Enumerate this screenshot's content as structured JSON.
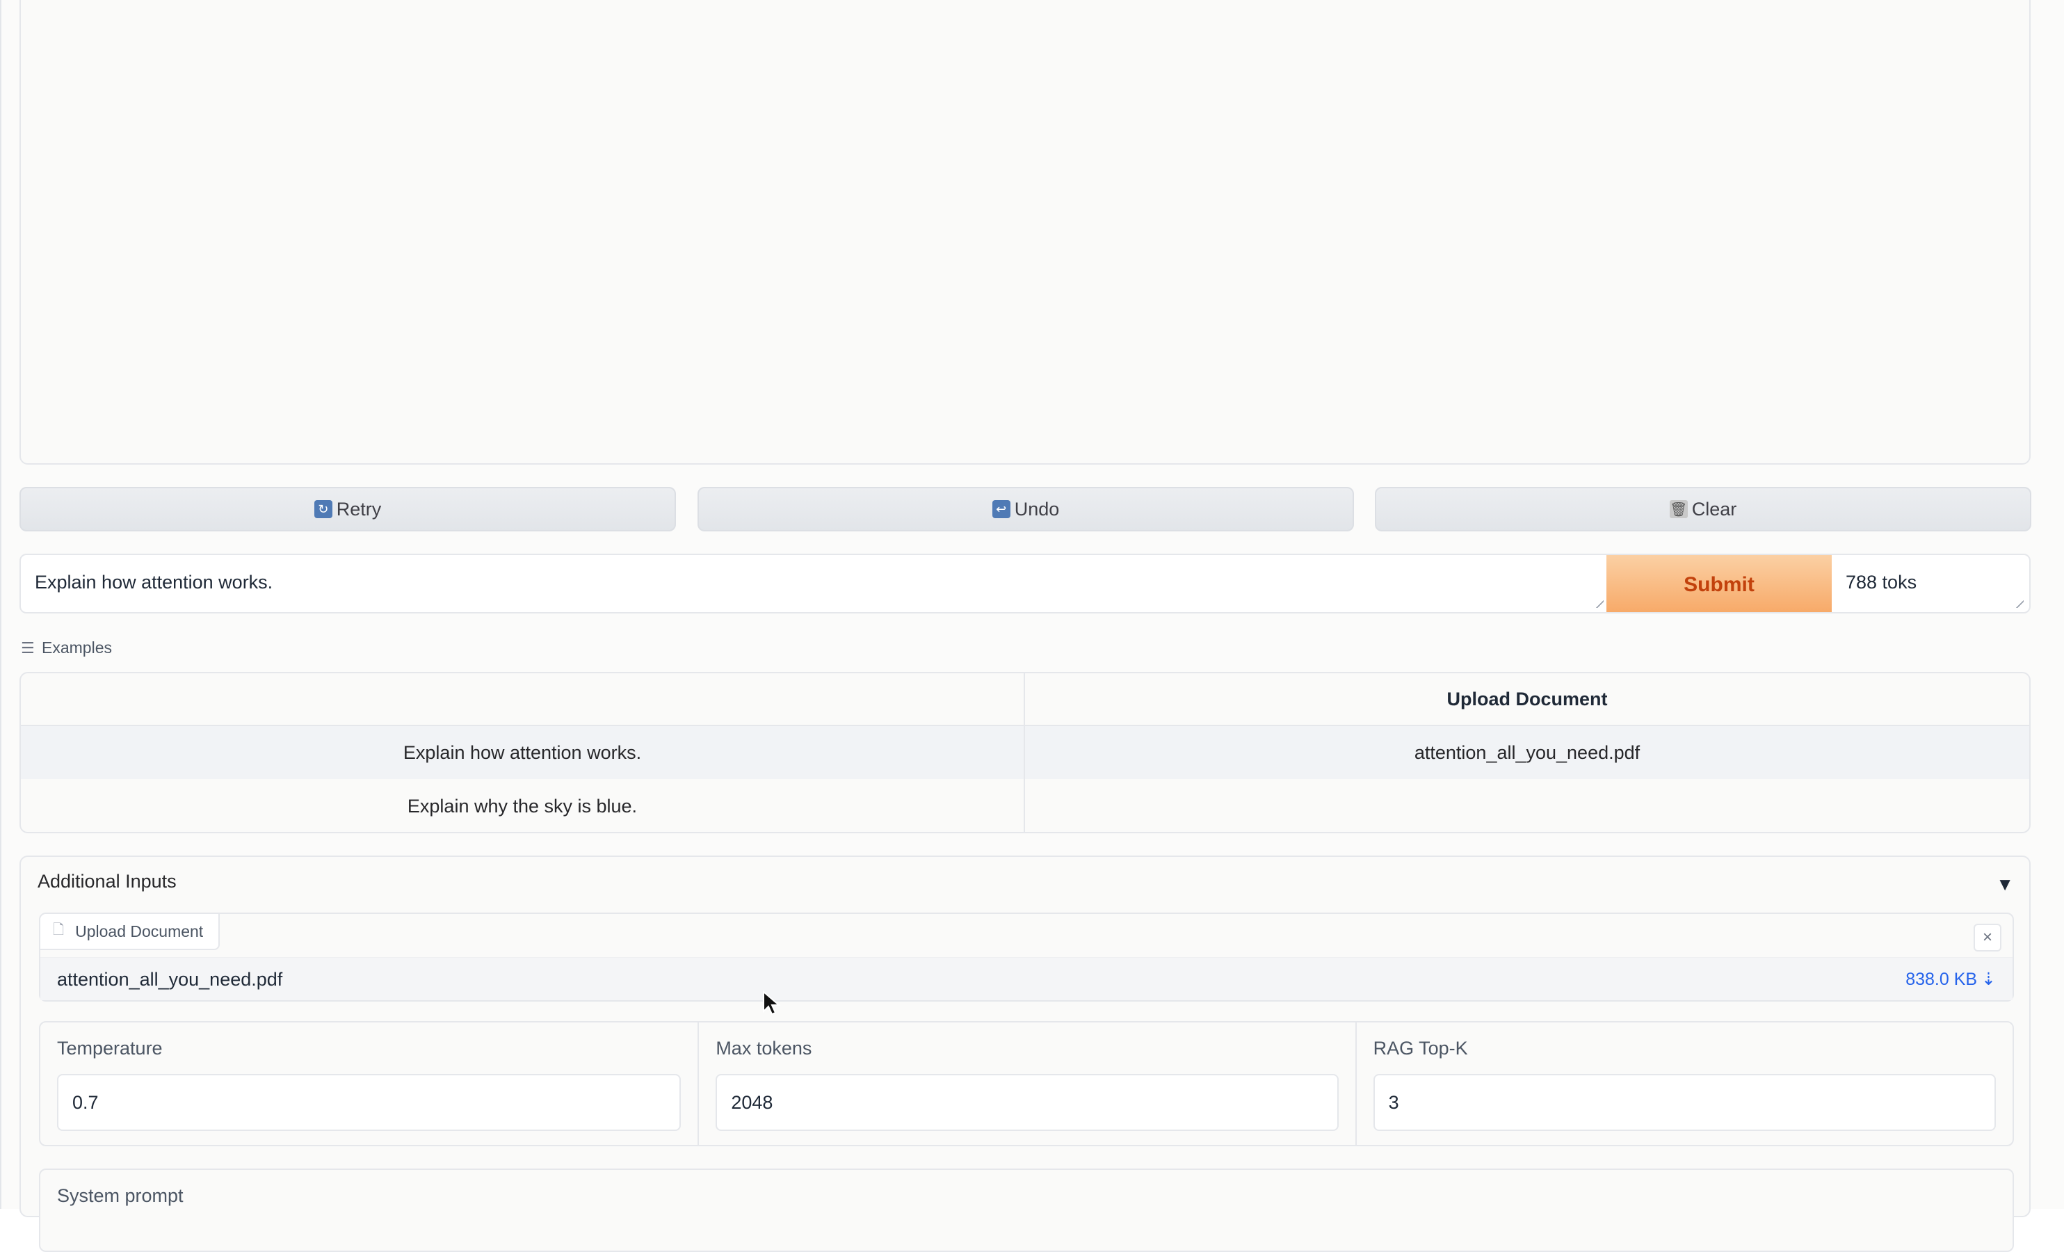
{
  "actions": {
    "retry": {
      "label": "Retry",
      "icon": "retry-icon"
    },
    "undo": {
      "label": "Undo",
      "icon": "undo-icon"
    },
    "clear": {
      "label": "Clear",
      "icon": "trash-icon"
    }
  },
  "message_input": {
    "value": "Explain how attention works.",
    "submit_label": "Submit",
    "token_count": "788 toks"
  },
  "examples": {
    "label": "Examples",
    "columns": [
      "",
      "Upload Document"
    ],
    "rows": [
      [
        "Explain how attention works.",
        "attention_all_you_need.pdf"
      ],
      [
        "Explain why the sky is blue.",
        ""
      ]
    ]
  },
  "additional_inputs": {
    "title": "Additional Inputs",
    "upload": {
      "label": "Upload Document",
      "file_name": "attention_all_you_need.pdf",
      "file_size": "838.0 KB",
      "clear_symbol": "×",
      "download_symbol": "⇣"
    },
    "params": [
      {
        "label": "Temperature",
        "value": "0.7"
      },
      {
        "label": "Max tokens",
        "value": "2048"
      },
      {
        "label": "RAG Top-K",
        "value": "3"
      }
    ],
    "system_prompt_label": "System prompt"
  },
  "colors": {
    "submit_bg": "#f7a866",
    "submit_text": "#c2410c",
    "link_blue": "#2563eb",
    "border": "#e5e7eb"
  }
}
